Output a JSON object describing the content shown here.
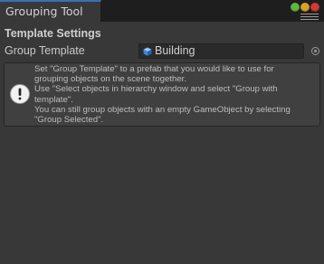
{
  "window": {
    "tab_title": "Grouping Tool",
    "controls": [
      "minimize",
      "maximize",
      "close"
    ]
  },
  "inspector": {
    "section_header": "Template Settings",
    "group_template": {
      "label": "Group Template",
      "value": "Building",
      "icon": "prefab-cube-icon"
    },
    "help": {
      "icon": "info-icon",
      "lines": [
        "Set \"Group Template\" to a prefab that you would like to use for",
        "grouping objects on the scene together.",
        "Use \"Select objects in hierarchy window and select \"Group with",
        "template\".",
        "You can still group objects with an empty GameObject by selecting",
        "\"Group Selected\"."
      ]
    }
  },
  "colors": {
    "background": "#383838",
    "tab_accent": "#3a6fb6",
    "minimize": "#5fb83c",
    "maximize": "#d9a32a",
    "close": "#d03b34"
  }
}
